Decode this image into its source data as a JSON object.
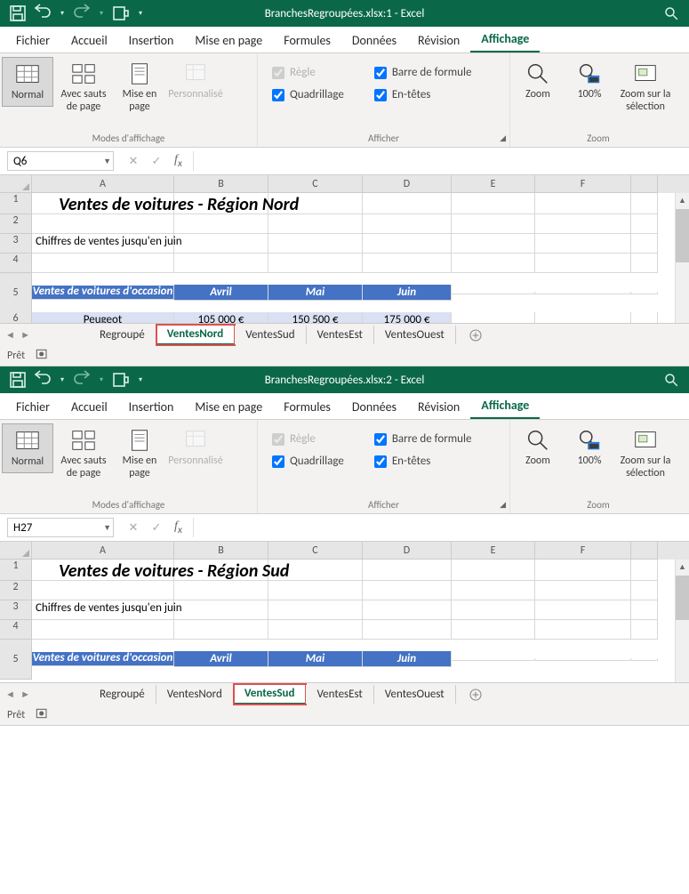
{
  "windows": [
    {
      "title_filename": "BranchesRegroupées.xlsx:1",
      "title_app": "Excel",
      "name_box": "Q6",
      "sheet_title": "Ventes de voitures - Région Nord",
      "subtitle": "Chiffres de ventes jusqu'en juin",
      "table_header_first": "Ventes de voitures d'occasion",
      "months": [
        "Avril",
        "Mai",
        "Juin"
      ],
      "data_row": {
        "label": "Peugeot",
        "vals": [
          "105 000 €",
          "150 500 €",
          "175 000 €"
        ]
      },
      "tabs": [
        "Regroupé",
        "VentesNord",
        "VentesSud",
        "VentesEst",
        "VentesOuest"
      ],
      "active_tab_index": 1,
      "status": "Prêt"
    },
    {
      "title_filename": "BranchesRegroupées.xlsx:2",
      "title_app": "Excel",
      "name_box": "H27",
      "sheet_title": "Ventes de voitures - Région Sud",
      "subtitle": "Chiffres de ventes jusqu'en juin",
      "table_header_first": "Ventes de voitures d'occasion",
      "months": [
        "Avril",
        "Mai",
        "Juin"
      ],
      "tabs": [
        "Regroupé",
        "VentesNord",
        "VentesSud",
        "VentesEst",
        "VentesOuest"
      ],
      "active_tab_index": 2,
      "status": "Prêt"
    }
  ],
  "ribbon": {
    "tabs": [
      "Fichier",
      "Accueil",
      "Insertion",
      "Mise en page",
      "Formules",
      "Données",
      "Révision",
      "Affichage"
    ],
    "active_tab": "Affichage",
    "group_modes": {
      "label": "Modes d'affichage",
      "normal": "Normal",
      "page_breaks": "Avec sauts de page",
      "page_layout": "Mise en page",
      "custom": "Personnalisé"
    },
    "group_show": {
      "label": "Afficher",
      "ruler": "Règle",
      "gridlines": "Quadrillage",
      "formula_bar": "Barre de formule",
      "headings": "En-têtes",
      "ruler_checked": true,
      "ruler_disabled": true,
      "gridlines_checked": true,
      "formula_bar_checked": true,
      "headings_checked": true
    },
    "group_zoom": {
      "label": "Zoom",
      "zoom": "Zoom",
      "hundred": "100%",
      "selection": "Zoom sur la sélection"
    }
  },
  "columns": [
    "A",
    "B",
    "C",
    "D",
    "E",
    "F"
  ],
  "rownums": [
    "1",
    "2",
    "3",
    "4",
    "5",
    "6"
  ]
}
